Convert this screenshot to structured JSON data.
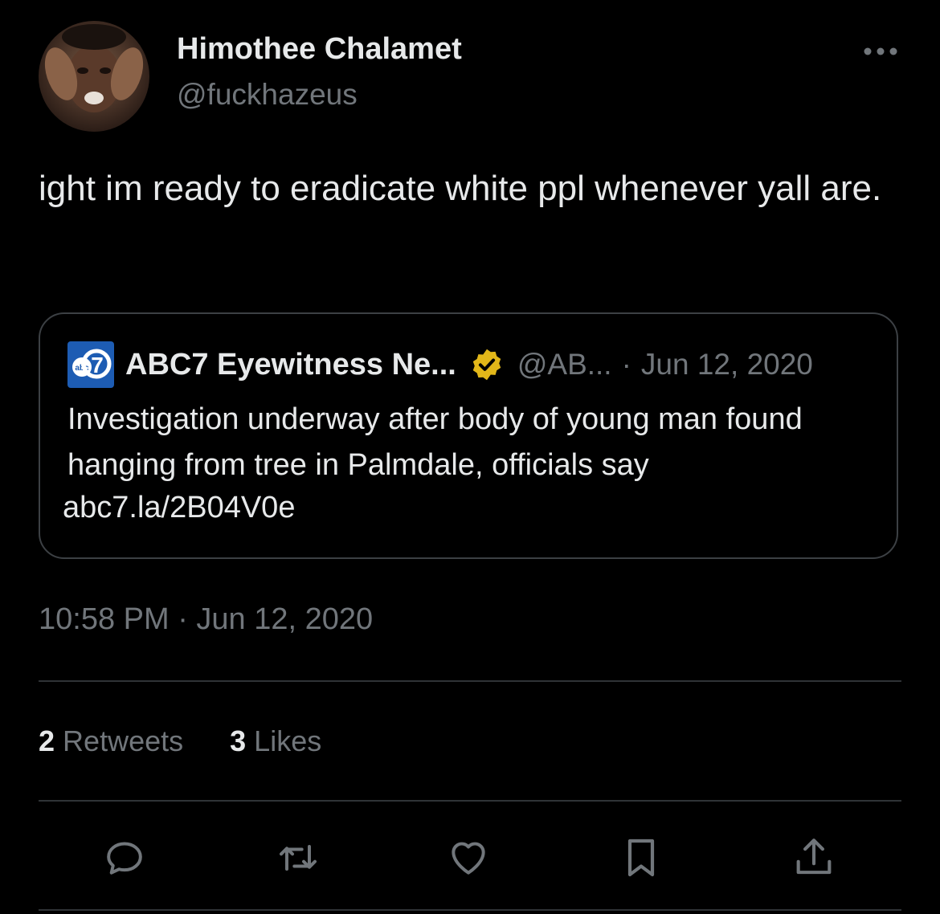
{
  "author": {
    "display_name": "Himothee Chalamet",
    "handle": "@fuckhazeus"
  },
  "tweet": {
    "text": "ight im ready to eradicate white ppl whenever yall are.",
    "timestamp": "10:58 PM · Jun 12, 2020"
  },
  "quoted_tweet": {
    "logo_text": "abc",
    "logo_number": "7",
    "name": "ABC7 Eyewitness Ne...",
    "handle": "@AB...",
    "separator": "·",
    "date": "Jun 12, 2020",
    "body": "Investigation underway after body of young man found hanging from tree in Palmdale, officials say",
    "link": "abc7.la/2B04V0e"
  },
  "stats": {
    "retweets_count": "2",
    "retweets_label": "Retweets",
    "likes_count": "3",
    "likes_label": "Likes"
  },
  "icons": {
    "more": "more-icon",
    "reply": "reply-icon",
    "retweet": "retweet-icon",
    "like": "heart-icon",
    "bookmark": "bookmark-icon",
    "share": "share-icon",
    "verified": "verified-badge-icon"
  },
  "colors": {
    "background": "#000000",
    "text_primary": "#e7e9ea",
    "text_secondary": "#71767b",
    "border": "#2f3336",
    "verified_gold": "#e2b719",
    "abc_blue": "#1d5cb3"
  }
}
